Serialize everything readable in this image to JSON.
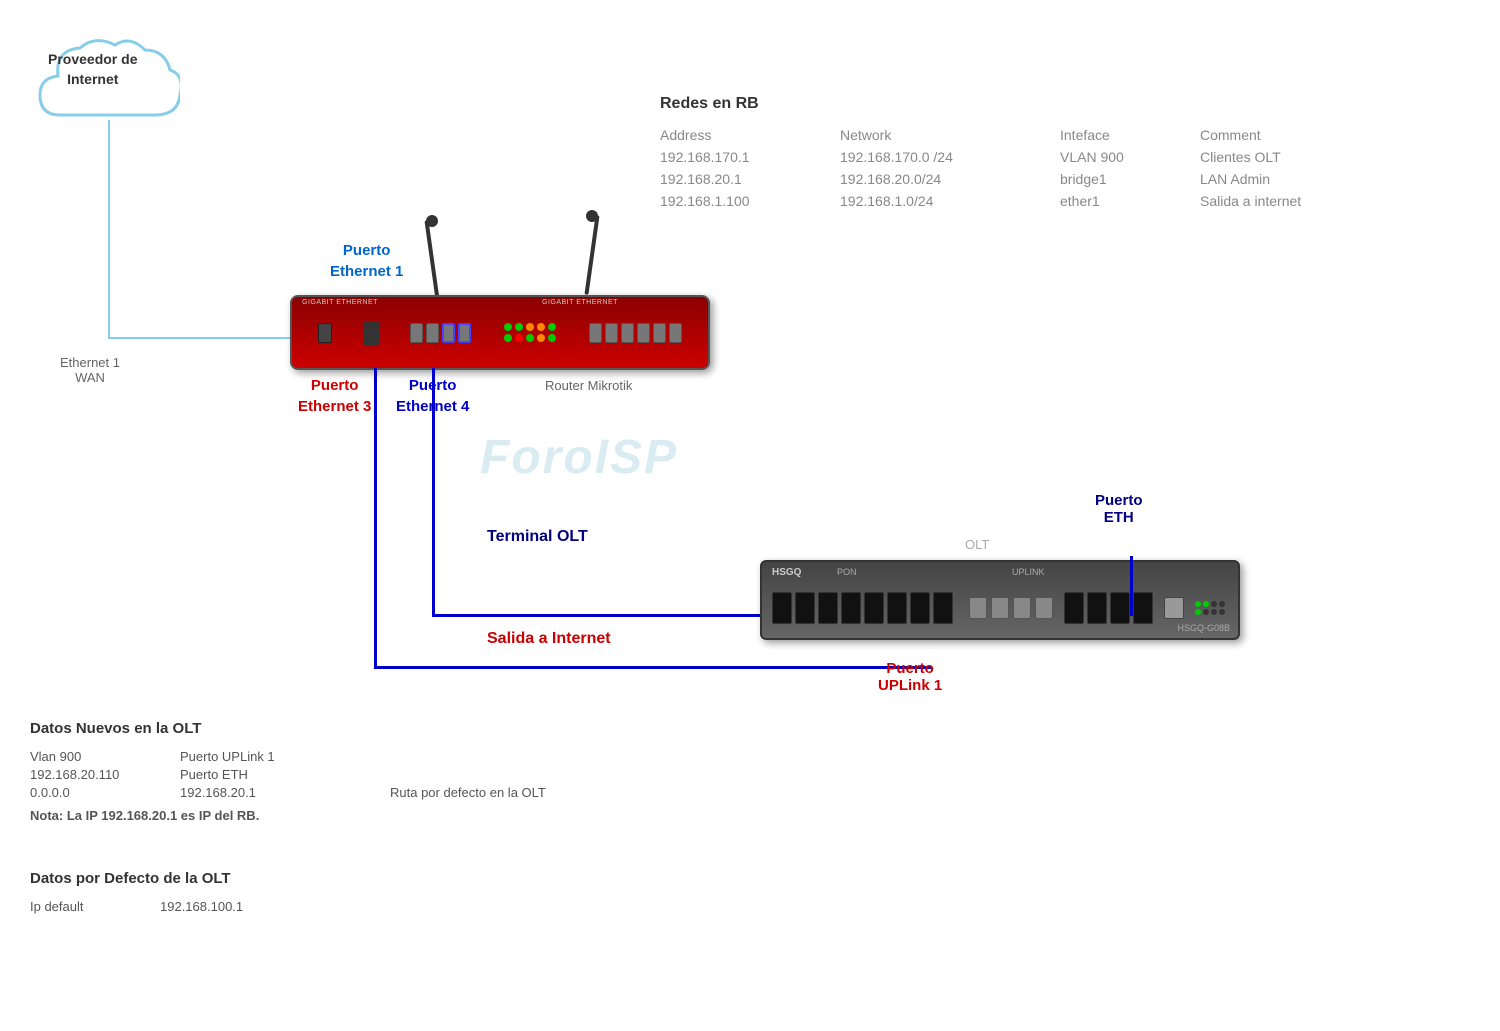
{
  "cloud": {
    "label_line1": "Proveedor de",
    "label_line2": "Internet"
  },
  "labels": {
    "eth1_wan": "Ethernet 1\nWAN",
    "puerto_eth1": "Puerto\nEthernet 1",
    "puerto_eth3": "Puerto\nEthernet 3",
    "puerto_eth4": "Puerto\nEthernet 4",
    "router_label": "Router Mikrotik",
    "terminal_olt": "Terminal OLT",
    "salida_internet": "Salida a Internet",
    "puerto_eth": "Puerto\nETH",
    "puerto_uplink": "Puerto\nUPLink 1",
    "watermark": "ForoISP"
  },
  "redes_rb": {
    "title": "Redes en RB",
    "headers": [
      "Address",
      "Network",
      "Inteface",
      "Comment"
    ],
    "rows": [
      [
        "192.168.170.1",
        "192.168.170.0 /24",
        "VLAN 900",
        "Clientes OLT"
      ],
      [
        "192.168.20.1",
        "192.168.20.0/24",
        "bridge1",
        "LAN Admin"
      ],
      [
        "192.168.1.100",
        "192.168.1.0/24",
        "ether1",
        "Salida a internet"
      ]
    ]
  },
  "datos_nuevos": {
    "title": "Datos Nuevos en  la OLT",
    "rows": [
      {
        "col1": "Vlan 900",
        "col2": "Puerto UPLink 1",
        "col3": ""
      },
      {
        "col1": "192.168.20.110",
        "col2": "Puerto ETH",
        "col3": ""
      },
      {
        "col1": "0.0.0.0",
        "col2": "192.168.20.1",
        "col3": "Ruta  por defecto en la OLT"
      }
    ],
    "note": "Nota: La IP 192.168.20.1 es IP del RB."
  },
  "datos_defecto": {
    "title": "Datos por Defecto de la OLT",
    "rows": [
      {
        "col1": "Ip default",
        "col2": "192.168.100.1"
      }
    ]
  },
  "olt_labels": {
    "top_label": "OLT",
    "brand": "HSGQ",
    "model": "HSGQ-G08B"
  }
}
